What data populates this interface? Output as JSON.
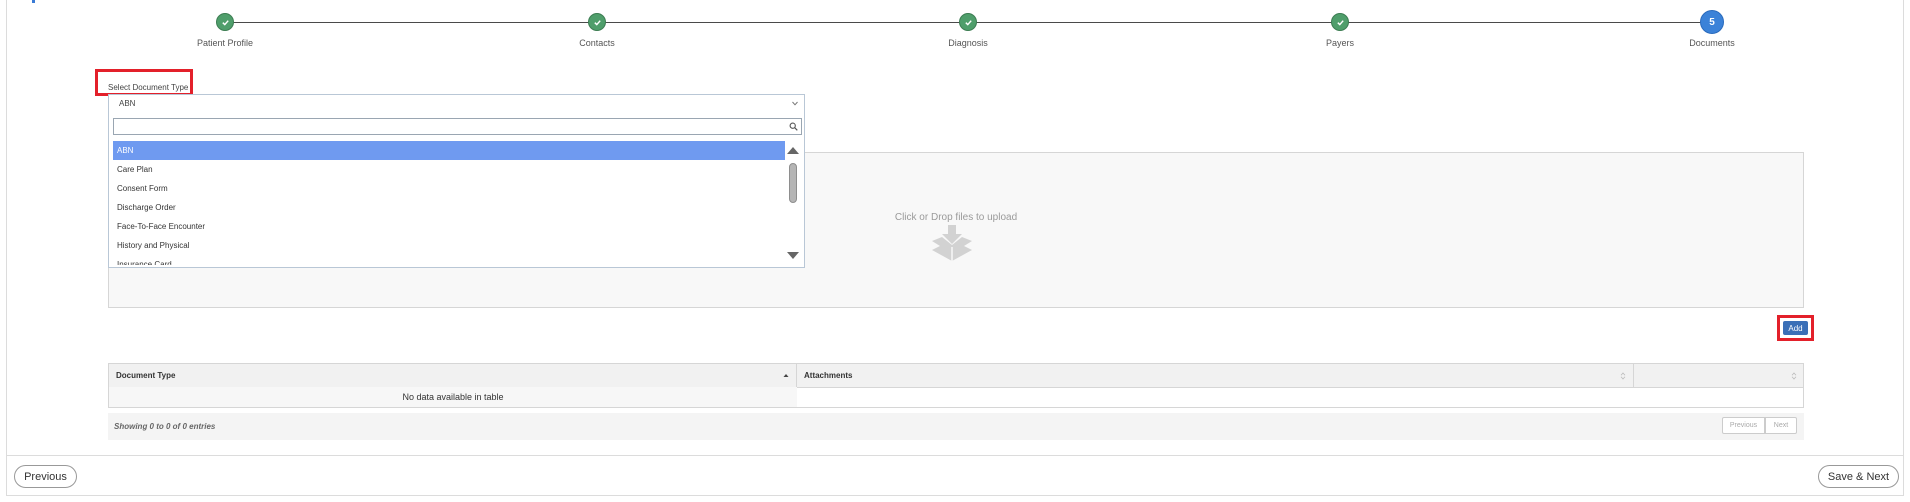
{
  "stepper": {
    "steps": [
      {
        "label": "Patient Profile",
        "status": "complete",
        "icon": "check-icon"
      },
      {
        "label": "Contacts",
        "status": "complete",
        "icon": "check-icon"
      },
      {
        "label": "Diagnosis",
        "status": "complete",
        "icon": "check-icon"
      },
      {
        "label": "Payers",
        "status": "complete",
        "icon": "check-icon"
      },
      {
        "label": "Documents",
        "status": "current",
        "number": "5"
      }
    ],
    "complete_color": "#4f9e6b",
    "current_color": "#3b82d8"
  },
  "document_type": {
    "label": "Select Document Type",
    "selected": "ABN",
    "search_value": "",
    "options": [
      "ABN",
      "Care Plan",
      "Consent Form",
      "Discharge Order",
      "Face-To-Face Encounter",
      "History and Physical",
      "Insurance Card"
    ]
  },
  "upload": {
    "text": "Click or Drop files to upload",
    "icon": "upload-box-icon"
  },
  "add_button": {
    "label": "Add"
  },
  "table": {
    "columns": [
      "Document Type",
      "Attachments",
      ""
    ],
    "empty_message": "No data available in table",
    "info": "Showing 0 to 0 of 0 entries",
    "pagination": {
      "previous": "Previous",
      "next": "Next"
    }
  },
  "footer": {
    "previous_label": "Previous",
    "save_next_label": "Save & Next"
  },
  "colors": {
    "highlight_border": "#e3202a",
    "selected_option": "#6f9af0",
    "primary_button": "#3a6fb7"
  }
}
